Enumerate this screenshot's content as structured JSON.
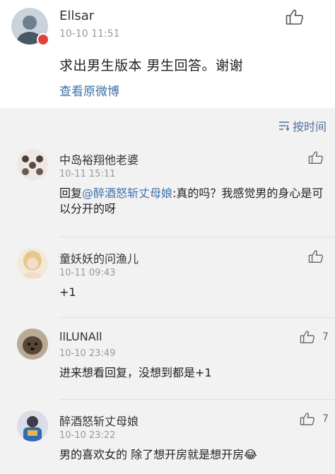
{
  "post": {
    "username": "Ellsar",
    "timestamp": "10-10 11:51",
    "text": "求出男生版本 男生回答。谢谢",
    "view_original": "查看原微博"
  },
  "sort": {
    "label": "按时间"
  },
  "comments": [
    {
      "username": "中岛裕翔他老婆",
      "timestamp": "10-11 15:11",
      "reply_prefix": "回复",
      "mention": "@醉酒怒斩丈母娘",
      "text": ":真的吗？我感觉男的身心是可以分开的呀",
      "likes": ""
    },
    {
      "username": "童妖妖的问渔儿",
      "timestamp": "10-11 09:43",
      "text": "+1",
      "likes": ""
    },
    {
      "username": "llLUNAll",
      "timestamp": "10-10 23:49",
      "text": "进来想看回复，没想到都是+1",
      "likes": "7"
    },
    {
      "username": "醉酒怒斩丈母娘",
      "timestamp": "10-10 23:22",
      "text": "男的喜欢女的 除了想开房就是想开房😂",
      "likes": "7"
    }
  ],
  "icons": {
    "like": "thumbs-up-icon",
    "sort": "sort-lines-icon",
    "badge": "verified-badge-icon"
  },
  "colors": {
    "link": "#3d72a8",
    "comment_bg": "#f2f2f2",
    "badge": "#e0433b"
  }
}
